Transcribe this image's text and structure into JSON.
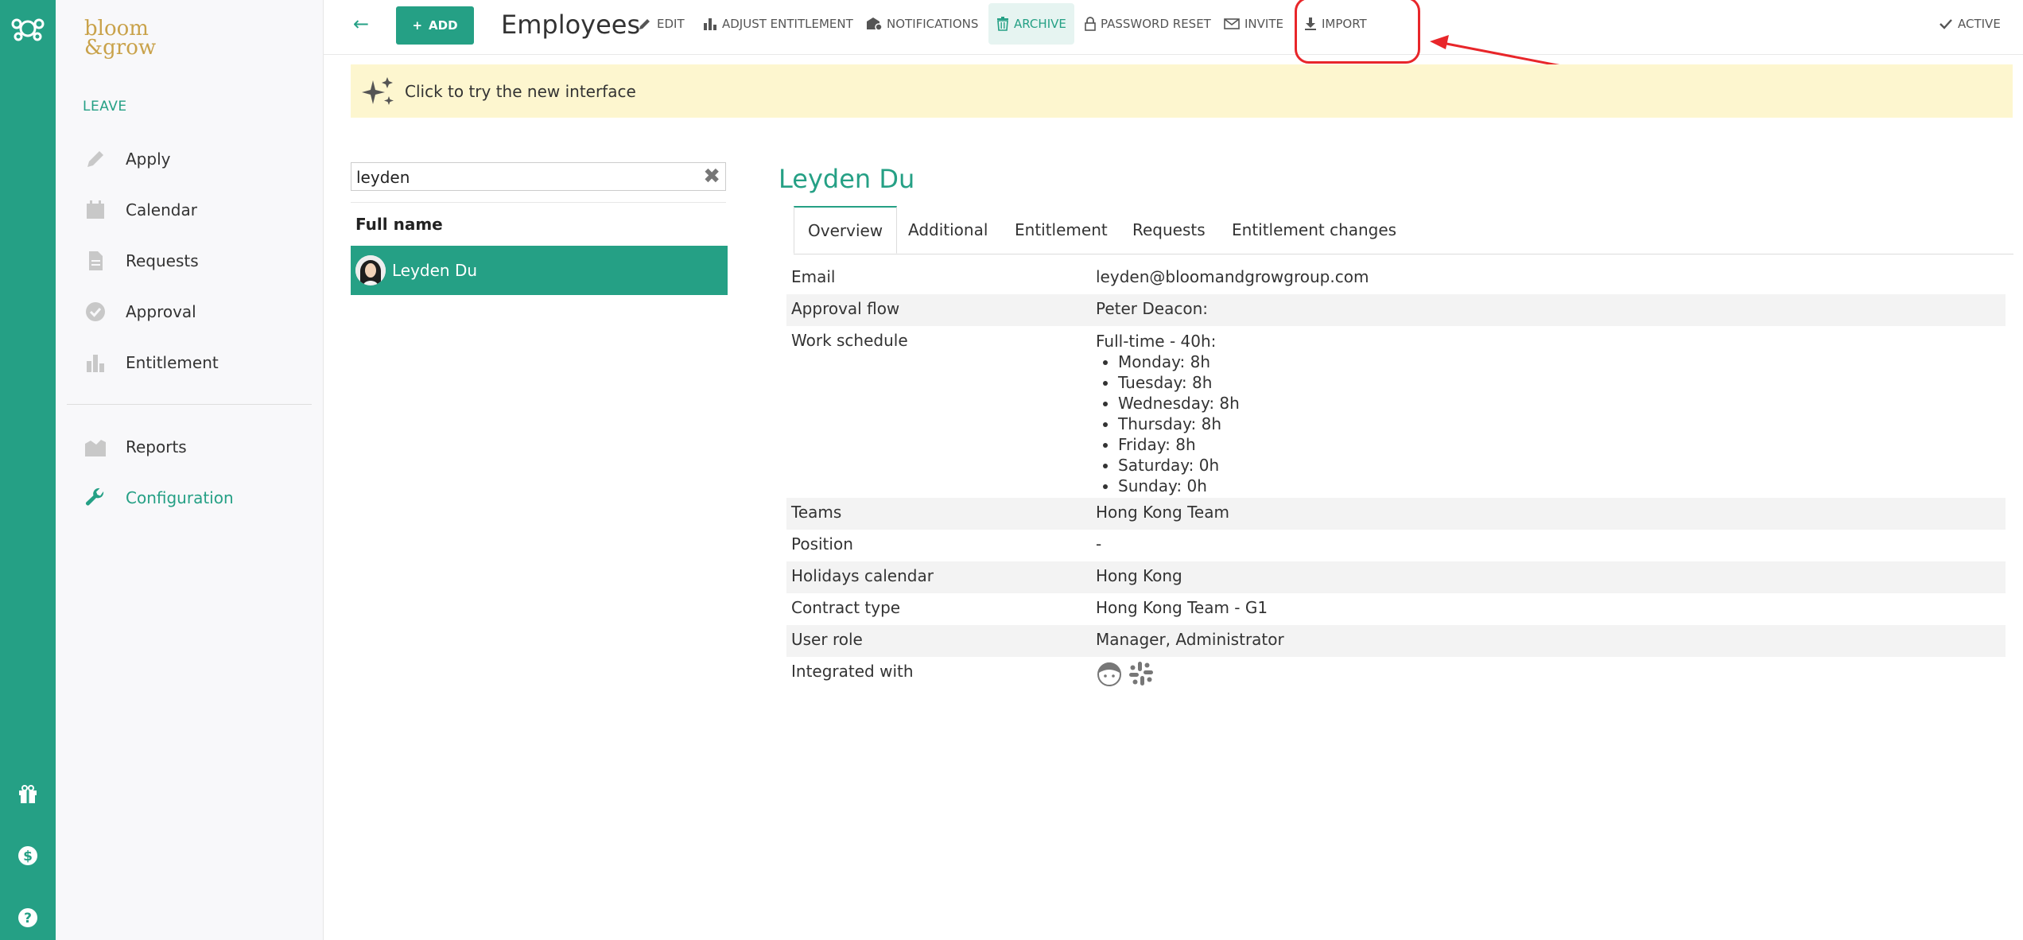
{
  "sidebar": {
    "section_label": "LEAVE",
    "items": [
      {
        "label": "Apply",
        "icon": "pencil-icon"
      },
      {
        "label": "Calendar",
        "icon": "calendar-icon"
      },
      {
        "label": "Requests",
        "icon": "document-icon"
      },
      {
        "label": "Approval",
        "icon": "check-circle-icon"
      },
      {
        "label": "Entitlement",
        "icon": "bar-chart-icon"
      }
    ],
    "items2": [
      {
        "label": "Reports",
        "icon": "reports-icon"
      },
      {
        "label": "Configuration",
        "icon": "wrench-icon",
        "active": true
      }
    ]
  },
  "toolbar": {
    "add_label": "ADD",
    "title": "Employees",
    "edit_label": "EDIT",
    "adjust_label": "ADJUST ENTITLEMENT",
    "notifications_label": "NOTIFICATIONS",
    "archive_label": "ARCHIVE",
    "password_reset_label": "PASSWORD RESET",
    "invite_label": "INVITE",
    "import_label": "IMPORT",
    "active_label": "ACTIVE"
  },
  "banner": {
    "text": "Click to try the new interface"
  },
  "search": {
    "value": "leyden"
  },
  "list": {
    "header": "Full name",
    "rows": [
      {
        "name": "Leyden Du"
      }
    ]
  },
  "employee": {
    "name": "Leyden Du",
    "tabs": [
      "Overview",
      "Additional",
      "Entitlement",
      "Requests",
      "Entitlement changes"
    ],
    "fields": {
      "email_k": "Email",
      "email_v": "leyden@bloomandgrowgroup.com",
      "approval_k": "Approval flow",
      "approval_v": "Peter Deacon:",
      "schedule_k": "Work schedule",
      "schedule_v": "Full-time - 40h:",
      "schedule_days": [
        "Monday: 8h",
        "Tuesday: 8h",
        "Wednesday: 8h",
        "Thursday: 8h",
        "Friday: 8h",
        "Saturday: 0h",
        "Sunday: 0h"
      ],
      "teams_k": "Teams",
      "teams_v": "Hong Kong Team",
      "position_k": "Position",
      "position_v": "-",
      "holidays_k": "Holidays calendar",
      "holidays_v": "Hong Kong",
      "contract_k": "Contract type",
      "contract_v": "Hong Kong Team - G1",
      "role_k": "User role",
      "role_v": "Manager, Administrator",
      "integrated_k": "Integrated with"
    }
  },
  "colors": {
    "brand": "#25a085",
    "banner": "#fdf6cf",
    "highlight": "#e8262a"
  }
}
